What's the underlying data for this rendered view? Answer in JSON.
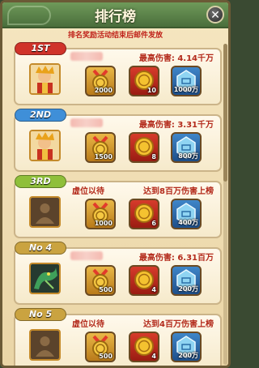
{
  "header": {
    "title": "排行榜",
    "close_label": "✕"
  },
  "notice": "排名奖励活动结束后邮件发放",
  "ranks": [
    {
      "rank_label": "1ST",
      "badge_color": "#d0332a",
      "occupied": true,
      "stat": "最高伤害: 4.14千万",
      "rewards": [
        {
          "icon": "medal-icon",
          "qty": "2000"
        },
        {
          "icon": "coin-icon",
          "qty": "10"
        },
        {
          "icon": "gem-icon",
          "qty": "1000万"
        }
      ]
    },
    {
      "rank_label": "2ND",
      "badge_color": "#3f8fd8",
      "occupied": true,
      "stat": "最高伤害: 3.31千万",
      "rewards": [
        {
          "icon": "medal-icon",
          "qty": "1500"
        },
        {
          "icon": "coin-icon",
          "qty": "8"
        },
        {
          "icon": "gem-icon",
          "qty": "800万"
        }
      ]
    },
    {
      "rank_label": "3RD",
      "badge_color": "#8fbf3a",
      "occupied": false,
      "vacant_label": "虚位以待",
      "stat": "达到8百万伤害上榜",
      "rewards": [
        {
          "icon": "medal-icon",
          "qty": "1000"
        },
        {
          "icon": "coin-icon",
          "qty": "6"
        },
        {
          "icon": "gem-icon",
          "qty": "400万"
        }
      ]
    },
    {
      "rank_label": "No 4",
      "badge_color": "#caa340",
      "occupied": true,
      "stat": "最高伤害: 6.31百万",
      "rewards": [
        {
          "icon": "medal-icon",
          "qty": "500"
        },
        {
          "icon": "coin-icon",
          "qty": "4"
        },
        {
          "icon": "gem-icon",
          "qty": "200万"
        }
      ]
    },
    {
      "rank_label": "No 5",
      "badge_color": "#caa340",
      "occupied": false,
      "vacant_label": "虚位以待",
      "stat": "达到4百万伤害上榜",
      "rewards": [
        {
          "icon": "medal-icon",
          "qty": "500"
        },
        {
          "icon": "coin-icon",
          "qty": "4"
        },
        {
          "icon": "gem-icon",
          "qty": "200万"
        }
      ]
    }
  ]
}
